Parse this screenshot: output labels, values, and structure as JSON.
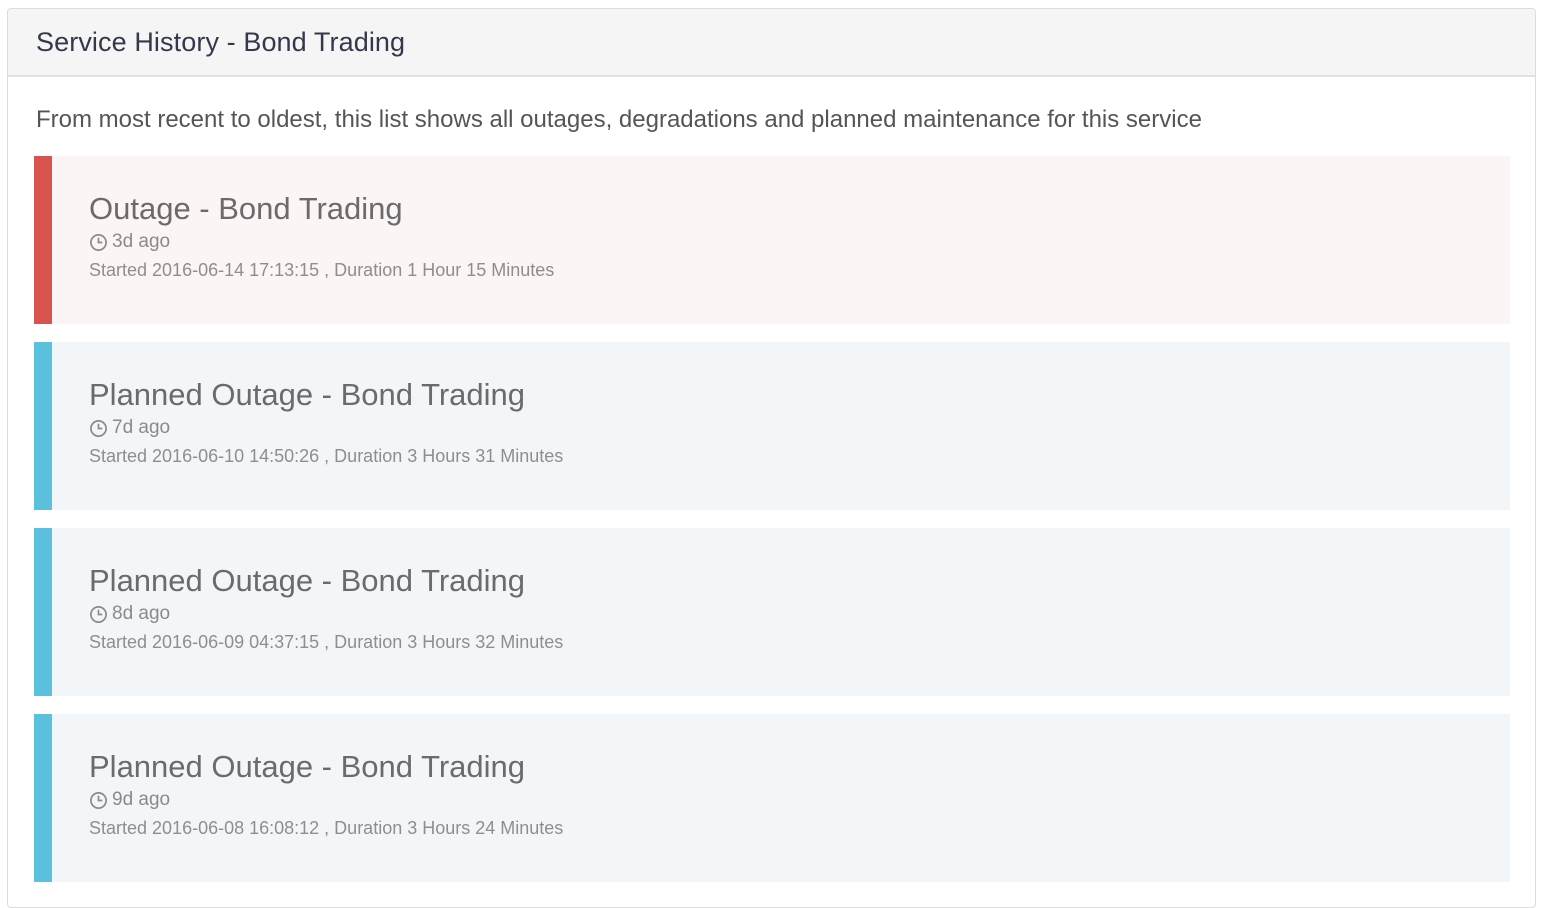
{
  "panel": {
    "title": "Service History - Bond Trading",
    "intro": "From most recent to oldest, this list shows all outages, degradations and planned maintenance for this service"
  },
  "colors": {
    "outage_bar": "#d9534f",
    "outage_bg": "#fcf5f5",
    "planned_bar": "#5bc0de",
    "planned_bg": "#f3f6f9"
  },
  "events": [
    {
      "kind": "outage",
      "title": "Outage - Bond Trading",
      "icon": "clock-icon",
      "ago": "3d ago",
      "meta": "Started 2016-06-14 17:13:15 , Duration 1 Hour 15 Minutes"
    },
    {
      "kind": "planned",
      "title": "Planned Outage - Bond Trading",
      "icon": "clock-icon",
      "ago": "7d ago",
      "meta": "Started 2016-06-10 14:50:26 , Duration 3 Hours 31 Minutes"
    },
    {
      "kind": "planned",
      "title": "Planned Outage - Bond Trading",
      "icon": "clock-icon",
      "ago": "8d ago",
      "meta": "Started 2016-06-09 04:37:15 , Duration 3 Hours 32 Minutes"
    },
    {
      "kind": "planned",
      "title": "Planned Outage - Bond Trading",
      "icon": "clock-icon",
      "ago": "9d ago",
      "meta": "Started 2016-06-08 16:08:12 , Duration 3 Hours 24 Minutes"
    }
  ]
}
